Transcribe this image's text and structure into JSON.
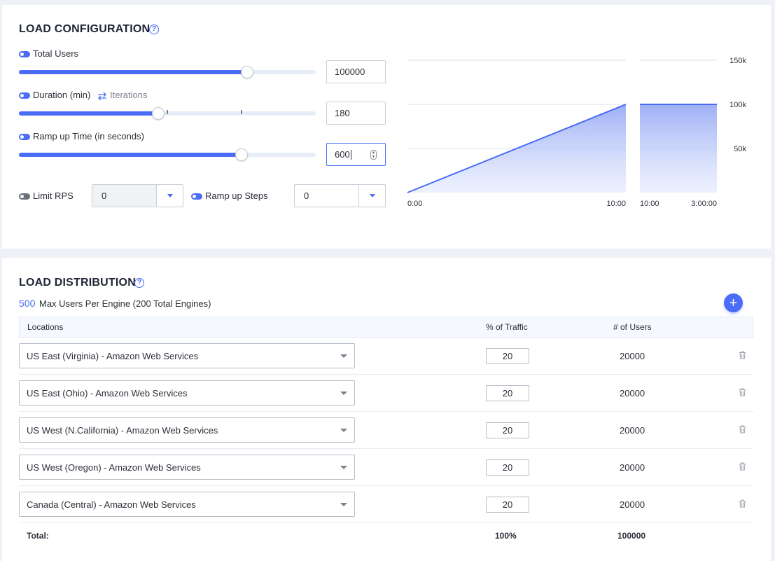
{
  "load_configuration": {
    "title": "LOAD CONFIGURATION",
    "help_icon": "question-circle-icon",
    "total_users": {
      "label": "Total Users",
      "value": "100000",
      "slider_level": 0.77
    },
    "duration": {
      "label": "Duration (min)",
      "alt_label": "Iterations",
      "swap_icon": "swap-arrows-icon",
      "value": "180",
      "slider_level": 0.47
    },
    "ramp_up": {
      "label": "Ramp up Time (in seconds)",
      "value": "600",
      "slider_level": 0.75
    },
    "limit_rps": {
      "label": "Limit RPS",
      "value": "0",
      "enabled": false
    },
    "ramp_up_steps": {
      "label": "Ramp up Steps",
      "value": "0",
      "enabled": true
    },
    "accent_color": "#4a6cf7"
  },
  "chart_data": {
    "type": "area",
    "title": "",
    "xlabel": "",
    "ylabel": "",
    "y_ticks": [
      "150k",
      "100k",
      "50k"
    ],
    "ylim": [
      0,
      150000
    ],
    "panels": [
      {
        "x_ticks": [
          "0:00",
          "10:00"
        ],
        "x": [
          "0:00",
          "10:00"
        ],
        "y": [
          0,
          100000
        ]
      },
      {
        "x_ticks": [
          "10:00",
          "3:00:00"
        ],
        "x": [
          "10:00",
          "3:00:00"
        ],
        "y": [
          100000,
          100000
        ]
      }
    ],
    "grid": true
  },
  "load_distribution": {
    "title": "LOAD DISTRIBUTION",
    "max_users": "500",
    "max_users_text": "Max Users Per Engine (200 Total Engines)",
    "add_icon": "plus-icon",
    "columns": {
      "locations": "Locations",
      "traffic": "% of Traffic",
      "users": "# of Users"
    },
    "rows": [
      {
        "location": "US East (Virginia) - Amazon Web Services",
        "traffic": "20",
        "users": "20000"
      },
      {
        "location": "US East (Ohio) - Amazon Web Services",
        "traffic": "20",
        "users": "20000"
      },
      {
        "location": "US West (N.California) - Amazon Web Services",
        "traffic": "20",
        "users": "20000"
      },
      {
        "location": "US West (Oregon) - Amazon Web Services",
        "traffic": "20",
        "users": "20000"
      },
      {
        "location": "Canada (Central) - Amazon Web Services",
        "traffic": "20",
        "users": "20000"
      }
    ],
    "total": {
      "label": "Total:",
      "traffic": "100%",
      "users": "100000"
    },
    "delete_icon": "trash-icon"
  }
}
